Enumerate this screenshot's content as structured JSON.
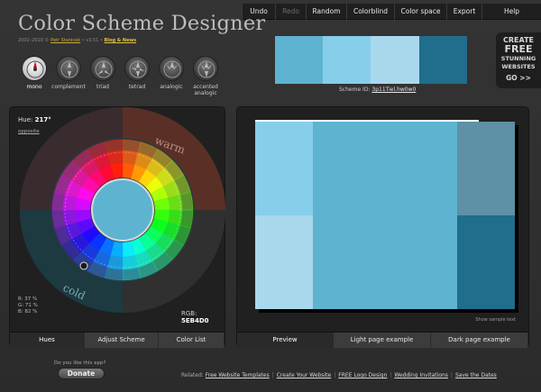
{
  "menu": {
    "items": [
      {
        "label": "Undo",
        "disabled": false
      },
      {
        "label": "Redo",
        "disabled": true
      },
      {
        "label": "Random",
        "disabled": false
      },
      {
        "label": "Colorblind",
        "disabled": false
      },
      {
        "label": "Color space",
        "disabled": false
      },
      {
        "label": "Export",
        "disabled": false
      },
      {
        "label": "Help",
        "disabled": false
      }
    ]
  },
  "header": {
    "title": "Color Scheme Designer",
    "subtitle_text": "2002–2010 © ",
    "author_link": "Petr Stanicek",
    "version": " • v3.51 • ",
    "blog_link": "Blog & News"
  },
  "scheme_types": [
    {
      "label": "mono",
      "active": true
    },
    {
      "label": "complement",
      "active": false
    },
    {
      "label": "triad",
      "active": false
    },
    {
      "label": "tetrad",
      "active": false
    },
    {
      "label": "analogic",
      "active": false
    },
    {
      "label": "accented analogic",
      "active": false
    }
  ],
  "swatches": {
    "colors": [
      "#5EB4D0",
      "#87CEEA",
      "#A9D8EC",
      "#216D8C"
    ],
    "scheme_id_label": "Scheme ID:",
    "scheme_id_value": "3p11Tiel.hw0w0"
  },
  "ad": {
    "line1": "CREATE",
    "line2": "FREE",
    "line3": "STUNNING",
    "line4": "WEBSITES",
    "line5": "GO >>"
  },
  "wheel_panel": {
    "hue_label": "Hue:",
    "hue_value": "217°",
    "opposite_link": "opposite",
    "warm_label": "warm",
    "cold_label": "cold",
    "r_label": "R: 37 %",
    "g_label": "G: 71 %",
    "b_label": "B: 82 %",
    "rgb_label": "RGB:",
    "rgb_value": "5EB4D0",
    "tabs": [
      {
        "label": "Hues",
        "active": true
      },
      {
        "label": "Adjust Scheme",
        "active": false
      },
      {
        "label": "Color List",
        "active": false
      }
    ]
  },
  "preview_panel": {
    "show_sample_text": "Show sample text",
    "colors": {
      "main": "#5EB4D0",
      "light1": "#87CEEA",
      "light2": "#A9D8EC",
      "dark1": "#5E90A6",
      "dark2": "#216D8C",
      "frame": "#ffffff",
      "shadow": "#000000"
    },
    "tabs": [
      {
        "label": "Preview",
        "active": true
      },
      {
        "label": "Light page example",
        "active": false
      },
      {
        "label": "Dark page example",
        "active": false
      }
    ]
  },
  "footer": {
    "like_text": "Do you like this app?",
    "donate_label": "Donate",
    "related_label": "Related:",
    "links": [
      "Free Website Templates",
      "Create Your Website",
      "FREE Logo Design",
      "Wedding Invitations",
      "Save the Dates"
    ]
  }
}
